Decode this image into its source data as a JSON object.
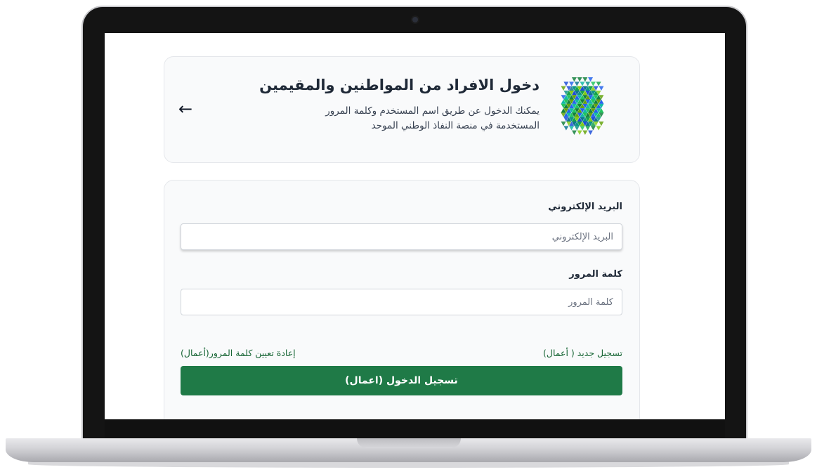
{
  "header": {
    "title": "دخول الافراد من المواطنين والمقيمين",
    "subtitle": "يمكنك الدخول عن طريق اسم المستخدم وكلمة المرور المستخدمة في منصة النفاذ الوطني الموحد",
    "back_icon": "←",
    "logo_icon": "national-single-sign-on-logo"
  },
  "form": {
    "email_label": "البريد الإلكتروني",
    "email_placeholder": "البريد الإلكتروني",
    "password_label": "كلمة المرور",
    "password_placeholder": "كلمة المرور",
    "register_link": "تسجيل جديد ( أعمال)",
    "reset_link": "إعادة تعيين كلمة المرور(أعمال)",
    "login_button": "تسجيل الدخول (اعمال)"
  },
  "colors": {
    "accent": "#1f7a47",
    "link": "#166534",
    "card_background": "#f9fafb"
  }
}
